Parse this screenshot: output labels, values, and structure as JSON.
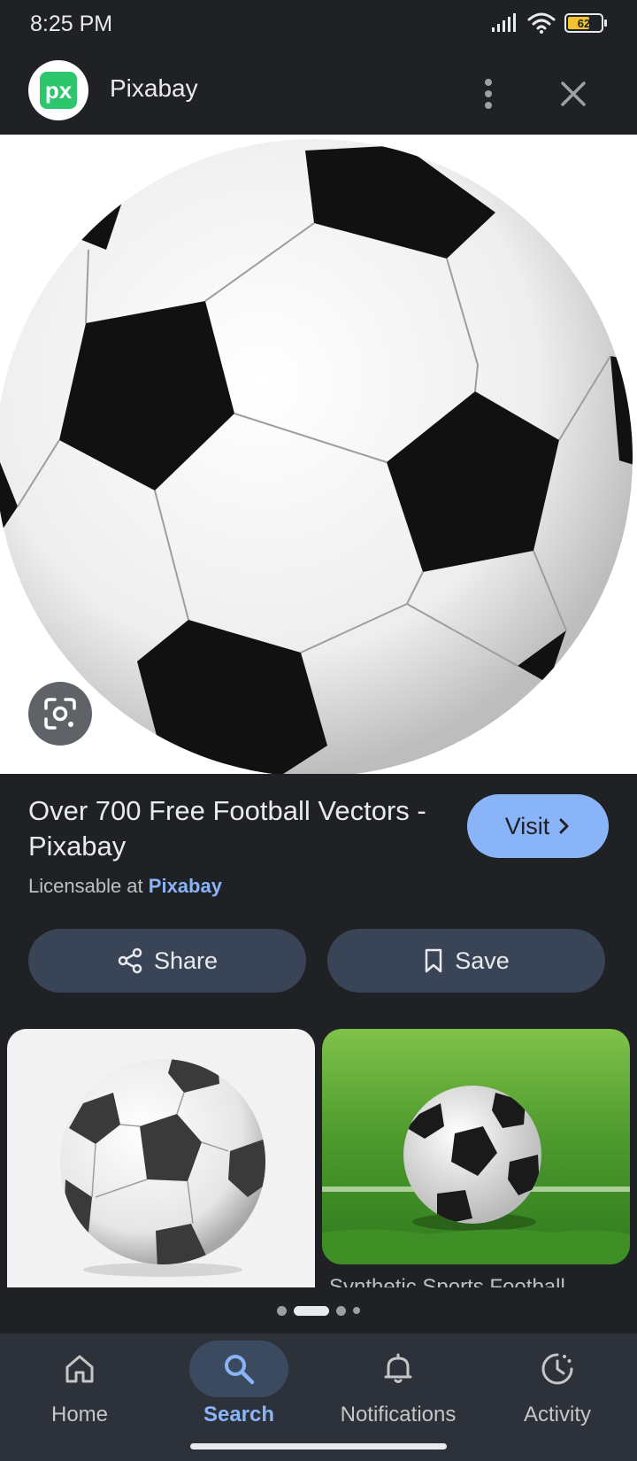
{
  "status_bar": {
    "time": "8:25 PM",
    "battery_level": "62"
  },
  "header": {
    "site_logo_text": "px",
    "site_name": "Pixabay"
  },
  "result": {
    "title": "Over 700 Free Football Vectors - Pixabay",
    "license_prefix": "Licensable at",
    "license_source": "Pixabay",
    "visit_label": "Visit"
  },
  "actions": {
    "share_label": "Share",
    "save_label": "Save"
  },
  "related": [
    {
      "caption": ""
    },
    {
      "caption": "Synthetic Sports Football"
    }
  ],
  "pagination": {
    "pages": 4,
    "active_index": 1
  },
  "bottom_nav": {
    "items": [
      {
        "label": "Home",
        "icon": "home-icon"
      },
      {
        "label": "Search",
        "icon": "search-icon",
        "active": true
      },
      {
        "label": "Notifications",
        "icon": "bell-icon"
      },
      {
        "label": "Activity",
        "icon": "activity-icon"
      }
    ]
  },
  "colors": {
    "background": "#202124",
    "accent": "#8ab4f8",
    "button": "#394457",
    "logo_green": "#2ec66d",
    "battery": "#f1c232"
  }
}
